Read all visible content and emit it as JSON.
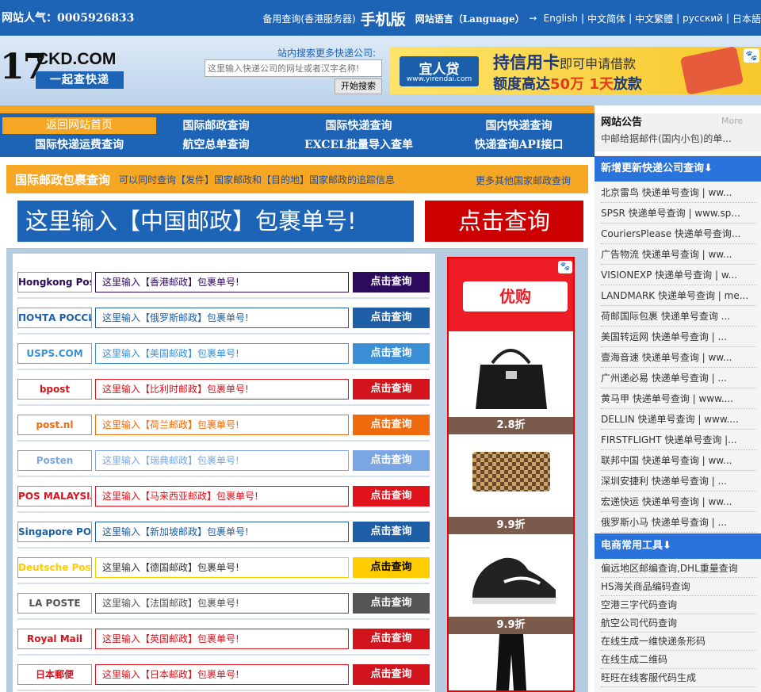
{
  "topbar": {
    "visits_label": "网站人气：0005926833",
    "inquiry_label": "备用查询(香港服务器)",
    "mobile_label": "手机版",
    "language_label": "网站语言（Language）",
    "arrow": "➙",
    "languages": [
      "English",
      "中文简体",
      "中文繁體",
      "русский",
      "日本語"
    ]
  },
  "logo": {
    "number": "17",
    "domain": "CKD.COM",
    "slogan": "一起查快递"
  },
  "search": {
    "label": "站内搜索更多快递公司:",
    "placeholder": "这里输入快递公司的网址或者汉字名称!",
    "button": "开始搜索"
  },
  "banner": {
    "brand": "宜人贷",
    "site": "www.yirendai.com",
    "line1_main": "持信用卡",
    "line1_sub": "即可申请借款",
    "line2_a": "额度高达",
    "line2_b": "50万",
    "line2_c": "1天",
    "line2_d": "放款",
    "paw": "🐾"
  },
  "nav": {
    "home": "返回网站首页",
    "items": [
      "国际邮政查询",
      "国际快递查询",
      "国内快递查询",
      "国际快递运费查询",
      "航空总单查询",
      "EXCEL批量导入查单",
      "快递查询API接口"
    ]
  },
  "notice": {
    "title": "网站公告",
    "more": "More",
    "item": "中邮给据邮件(国内小包)的单..."
  },
  "intl": {
    "title": "国际邮政包裹查询",
    "desc": "可以同时查询【发件】国家邮政和【目的地】国家邮政的追踪信息",
    "more": "更多其他国家邮政查询"
  },
  "bigsearch": {
    "placeholder": "这里输入【中国邮政】包裹单号!",
    "button": "点击查询"
  },
  "posts": [
    {
      "logo": "Hongkong Post",
      "input": "这里输入【香港邮政】包裹单号!",
      "button": "点击查询",
      "color": "#2d0a5e"
    },
    {
      "logo": "ПОЧТА РОССИИ",
      "input": "这里输入【俄罗斯邮政】包裹单号!",
      "button": "点击查询",
      "color": "#1f5fa6"
    },
    {
      "logo": "USPS.COM",
      "input": "这里输入【美国邮政】包裹单号!",
      "button": "点击查询",
      "color": "#3b8fd6"
    },
    {
      "logo": "bpost",
      "input": "这里输入【比利时邮政】包裹单号!",
      "button": "点击查询",
      "color": "#d2151d"
    },
    {
      "logo": "post.nl",
      "input": "这里输入【荷兰邮政】包裹单号!",
      "button": "点击查询",
      "color": "#f06a0e"
    },
    {
      "logo": "Posten",
      "input": "这里输入【瑞典邮政】包裹单号!",
      "button": "点击查询",
      "color": "#7aa6e3"
    },
    {
      "logo": "POS MALAYSIA",
      "input": "这里输入【马来西亚邮政】包裹单号!",
      "button": "点击查询",
      "color": "#e0121c"
    },
    {
      "logo": "Singapore POST",
      "input": "这里输入【新加坡邮政】包裹单号!",
      "button": "点击查询",
      "color": "#1d5ea6"
    },
    {
      "logo": "Deutsche Post",
      "input": "这里输入【德国邮政】包裹单号!",
      "button": "点击查询",
      "color": "#ffcc00"
    },
    {
      "logo": "LA POSTE",
      "input": "这里输入【法国邮政】包裹单号!",
      "button": "点击查询",
      "color": "#555555"
    },
    {
      "logo": "Royal Mail",
      "input": "这里输入【英国邮政】包裹单号!",
      "button": "点击查询",
      "color": "#d2151d"
    },
    {
      "logo": "日本郵便",
      "input": "这里输入【日本邮政】包裹单号!",
      "button": "点击查询",
      "color": "#d2151d"
    }
  ],
  "ad": {
    "logo": "优购 yougou.com",
    "paw": "🐾",
    "discounts": [
      "2.8折",
      "9.9折",
      "9.9折"
    ]
  },
  "right": {
    "new_title": "新增更新快递公司查询⬇",
    "new_items": [
      "北京雷鸟 快递单号查询 | ww...",
      "SPSR 快递单号查询 | www.sp...",
      "CouriersPlease 快递单号查询...",
      "广告物流 快递单号查询 | ww...",
      "VISIONEXP 快递单号查询 | w...",
      "LANDMARK 快递单号查询 | me...",
      "荷邮国际包裹 快递单号查询 ...",
      "美国转运网 快递单号查询 | ...",
      "壹海音速 快递单号查询 | ww...",
      "广州递必易 快递单号查询 | ...",
      "黄马甲 快递单号查询 | www....",
      "DELLIN 快递单号查询 | www....",
      "FIRSTFLIGHT 快递单号查询 |...",
      "联邦中国 快递单号查询 | ww...",
      "深圳安捷利 快递单号查询 | ...",
      "宏递快运 快递单号查询 | ww...",
      "俄罗斯小马 快递单号查询 | ..."
    ],
    "tools_title": "电商常用工具⬇",
    "tools": [
      "偏远地区邮编查询,DHL重量查询",
      "HS海关商品编码查询",
      "空港三字代码查询",
      "航空公司代码查询",
      "在线生成一维快递条形码",
      "在线生成二维码",
      "旺旺在线客服代码生成"
    ]
  }
}
